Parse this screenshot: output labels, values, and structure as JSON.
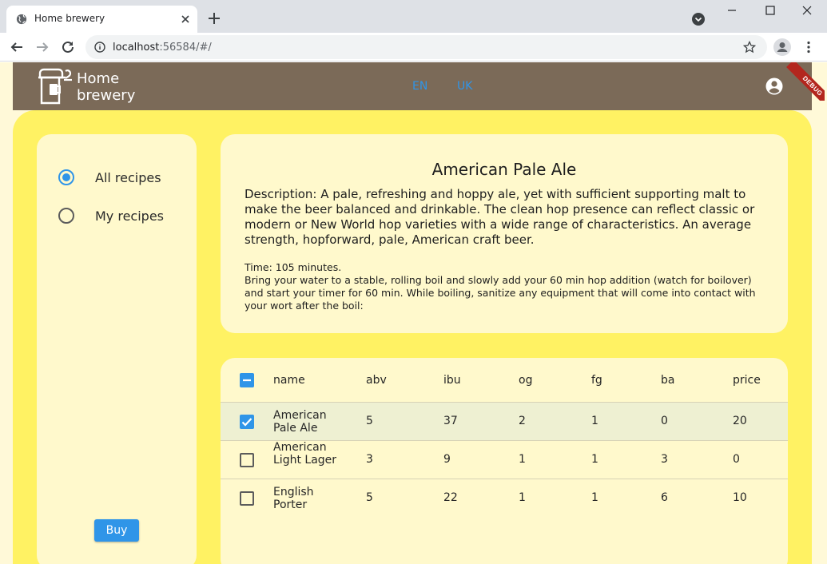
{
  "browser": {
    "tab_title": "Home brewery",
    "url_host": "localhost",
    "url_rest": ":56584/#/"
  },
  "appbar": {
    "brand_line1": "Home",
    "brand_line2": "brewery",
    "lang_en": "EN",
    "lang_uk": "UK",
    "debug_label": "DEBUG",
    "bar_color": "#7b6a58"
  },
  "sidebar": {
    "filters": [
      {
        "label": "All recipes",
        "selected": true
      },
      {
        "label": "My recipes",
        "selected": false
      }
    ],
    "buy_label": "Buy"
  },
  "recipe": {
    "title": "American Pale Ale",
    "description": "Description: A pale, refreshing and hoppy ale, yet with sufficient supporting malt to make the beer balanced and drinkable. The clean hop presence can reflect classic or modern or New World hop varieties with a wide range of characteristics. An average strength, hopforward, pale, American craft beer.",
    "time_line": "Time: 105 minutes.",
    "instructions": "Bring your water to a stable, rolling boil and slowly add your 60 min hop addition (watch for boilover) and start your timer for 60 min. While boiling, sanitize any equipment that will come into contact with your wort after the boil:"
  },
  "table": {
    "columns": [
      "name",
      "abv",
      "ibu",
      "og",
      "fg",
      "ba",
      "price"
    ],
    "rows": [
      {
        "name": "American Pale Ale",
        "abv": "5",
        "ibu": "37",
        "og": "2",
        "fg": "1",
        "ba": "0",
        "price": "20",
        "checked": true
      },
      {
        "name": "American Light Lager",
        "abv": "3",
        "ibu": "9",
        "og": "1",
        "fg": "1",
        "ba": "3",
        "price": "0",
        "checked": false
      },
      {
        "name": "English Porter",
        "abv": "5",
        "ibu": "22",
        "og": "1",
        "fg": "1",
        "ba": "6",
        "price": "10",
        "checked": false
      }
    ]
  },
  "colors": {
    "accent": "#2f95e8",
    "content_bg": "#fff263",
    "card_bg": "#fff9cc"
  }
}
